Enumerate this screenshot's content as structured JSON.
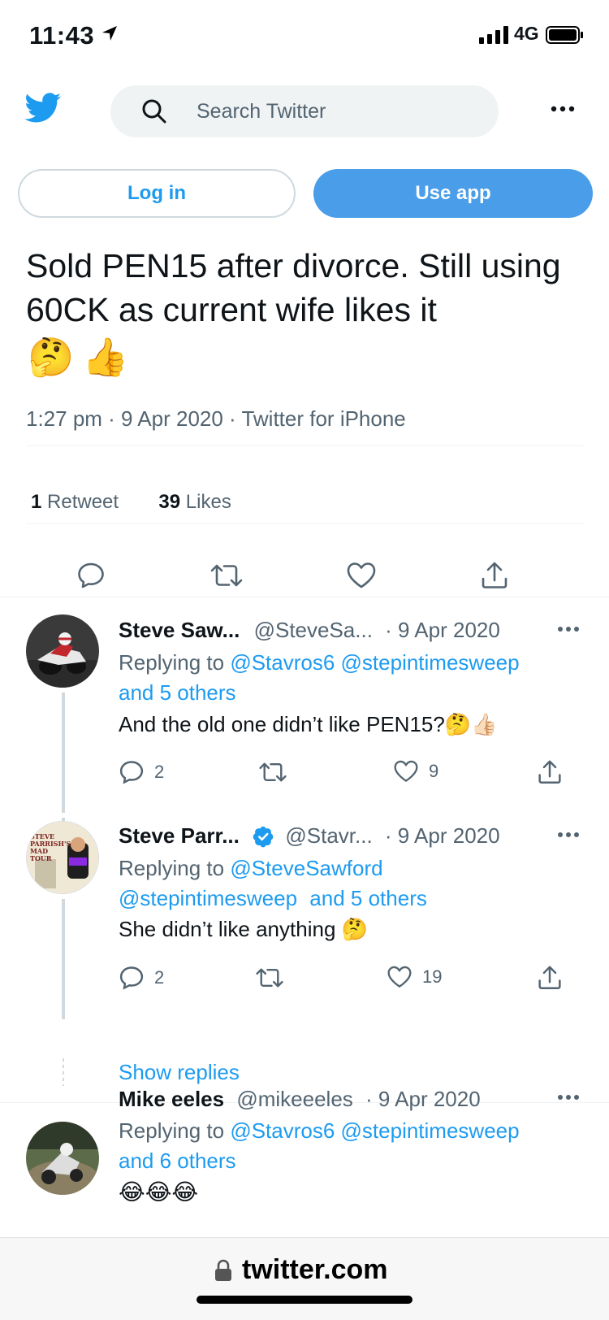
{
  "status_bar": {
    "time": "11:43",
    "network": "4G"
  },
  "header": {
    "search_placeholder": "Search Twitter",
    "login_label": "Log in",
    "use_app_label": "Use app"
  },
  "tweet": {
    "text": "Sold PEN15 after divorce. Still using 60CK as current wife likes it",
    "emojis": [
      "🤔",
      "👍"
    ],
    "meta": "1:27 pm · 9 Apr 2020 · Twitter for iPhone",
    "retweets_count": "1",
    "retweets_label": "Retweet",
    "likes_count": "39",
    "likes_label": "Likes"
  },
  "replies": [
    {
      "name": "Steve Saw...",
      "handle": "@SteveSa...",
      "date": "· 9 Apr 2020",
      "replying_prefix": "Replying to",
      "replying_links": "@Stavros6 @stepintimesweep",
      "replying_more": "and 5 others",
      "text": "And the old one didn’t like PEN15?🤔👍🏻",
      "reply_count": "2",
      "retweet_count": "",
      "like_count": "9"
    },
    {
      "name": "Steve Parr...",
      "handle": "@Stavr...",
      "date": "· 9 Apr 2020",
      "replying_prefix": "Replying to",
      "replying_links_1": "@SteveSawford",
      "replying_links_2": "@stepintimesweep",
      "replying_more": "and 5 others",
      "text": "She didn’t like anything 🤔",
      "reply_count": "2",
      "retweet_count": "",
      "like_count": "19",
      "avatar_text": "STEVE PARRISH'S MAD TOUR"
    },
    {
      "name": "Mike eeles",
      "handle": "@mikeeeles",
      "date": "· 9 Apr 2020",
      "replying_prefix": "Replying to",
      "replying_links": "@Stavros6 @stepintimesweep",
      "replying_more": "and 6 others",
      "text": "😂😂😂"
    }
  ],
  "show_replies_label": "Show replies",
  "url": "twitter.com",
  "colors": {
    "accent": "#1d9bf0",
    "text": "#0f1419",
    "muted": "#536471"
  }
}
